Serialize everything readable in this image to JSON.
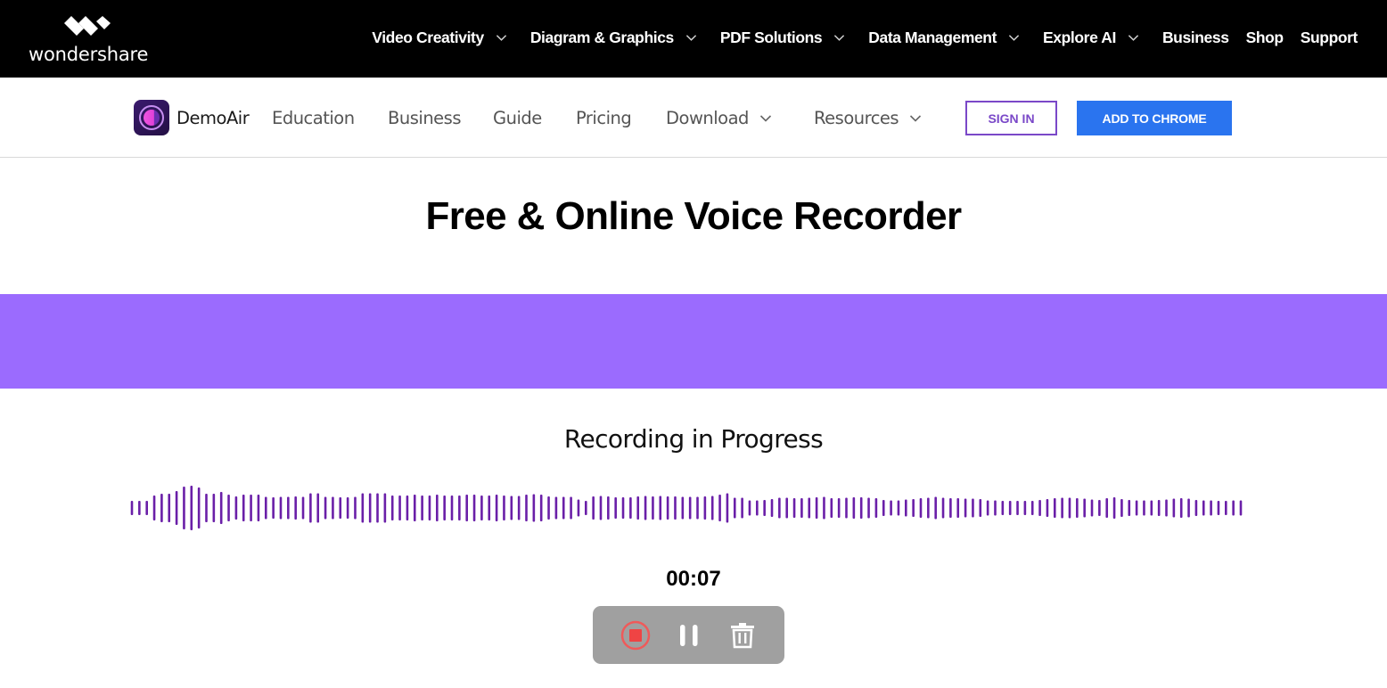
{
  "brand": {
    "company": "wondershare",
    "product": "DemoAir"
  },
  "topnav": [
    {
      "label": "Video Creativity",
      "has_menu": true
    },
    {
      "label": "Diagram & Graphics",
      "has_menu": true
    },
    {
      "label": "PDF Solutions",
      "has_menu": true
    },
    {
      "label": "Data Management",
      "has_menu": true
    },
    {
      "label": "Explore AI",
      "has_menu": true
    },
    {
      "label": "Business",
      "has_menu": false
    },
    {
      "label": "Shop",
      "has_menu": false
    },
    {
      "label": "Support",
      "has_menu": false
    }
  ],
  "subnav": [
    {
      "label": "Education",
      "has_menu": false
    },
    {
      "label": "Business",
      "has_menu": false
    },
    {
      "label": "Guide",
      "has_menu": false
    },
    {
      "label": "Pricing",
      "has_menu": false
    },
    {
      "label": "Download",
      "has_menu": true
    },
    {
      "label": "Resources",
      "has_menu": true
    }
  ],
  "buttons": {
    "sign_in": "SIGN IN",
    "add_to_chrome": "ADD TO CHROME"
  },
  "page": {
    "title": "Free & Online Voice Recorder"
  },
  "recorder": {
    "status": "Recording in Progress",
    "elapsed": "00:07",
    "controls": {
      "stop": "stop-recording",
      "pause": "pause-recording",
      "delete": "delete-recording"
    },
    "waveform_amplitudes": [
      0.32,
      0.32,
      0.32,
      0.56,
      0.64,
      0.64,
      0.76,
      0.96,
      1.0,
      0.92,
      0.64,
      0.64,
      0.72,
      0.6,
      0.52,
      0.6,
      0.6,
      0.6,
      0.5,
      0.48,
      0.5,
      0.5,
      0.52,
      0.5,
      0.66,
      0.66,
      0.5,
      0.5,
      0.48,
      0.48,
      0.5,
      0.66,
      0.66,
      0.66,
      0.66,
      0.56,
      0.56,
      0.56,
      0.6,
      0.56,
      0.56,
      0.6,
      0.56,
      0.56,
      0.56,
      0.6,
      0.6,
      0.56,
      0.56,
      0.6,
      0.56,
      0.54,
      0.54,
      0.6,
      0.62,
      0.6,
      0.52,
      0.5,
      0.5,
      0.5,
      0.38,
      0.32,
      0.52,
      0.54,
      0.52,
      0.48,
      0.48,
      0.48,
      0.52,
      0.54,
      0.52,
      0.54,
      0.52,
      0.52,
      0.5,
      0.5,
      0.5,
      0.52,
      0.54,
      0.6,
      0.66,
      0.46,
      0.46,
      0.34,
      0.34,
      0.36,
      0.4,
      0.46,
      0.46,
      0.44,
      0.44,
      0.46,
      0.48,
      0.5,
      0.44,
      0.44,
      0.46,
      0.48,
      0.48,
      0.46,
      0.44,
      0.36,
      0.34,
      0.34,
      0.38,
      0.4,
      0.44,
      0.46,
      0.5,
      0.46,
      0.44,
      0.44,
      0.42,
      0.42,
      0.4,
      0.34,
      0.34,
      0.32,
      0.32,
      0.32,
      0.32,
      0.32,
      0.36,
      0.4,
      0.44,
      0.46,
      0.46,
      0.44,
      0.42,
      0.38,
      0.36,
      0.44,
      0.48,
      0.4,
      0.36,
      0.34,
      0.34,
      0.34,
      0.36,
      0.38,
      0.42,
      0.44,
      0.42,
      0.36,
      0.34,
      0.34,
      0.32,
      0.32,
      0.34,
      0.34
    ]
  },
  "colors": {
    "topbar_bg": "#000000",
    "band": "#9b6bfe",
    "waveform": "#6a1fa8",
    "sign_in_accent": "#7a48c8",
    "add_to_chrome_bg": "#2a74ef",
    "controls_bg": "#a0a0a0",
    "stop_red": "#ef4444"
  },
  "icons": {
    "logo_mark": "wondershare-diamond-mark",
    "product_logo": "demoair-orb-icon",
    "chevron": "chevron-down-icon",
    "stop": "stop-circle-icon",
    "pause": "pause-icon",
    "delete": "trash-icon"
  }
}
